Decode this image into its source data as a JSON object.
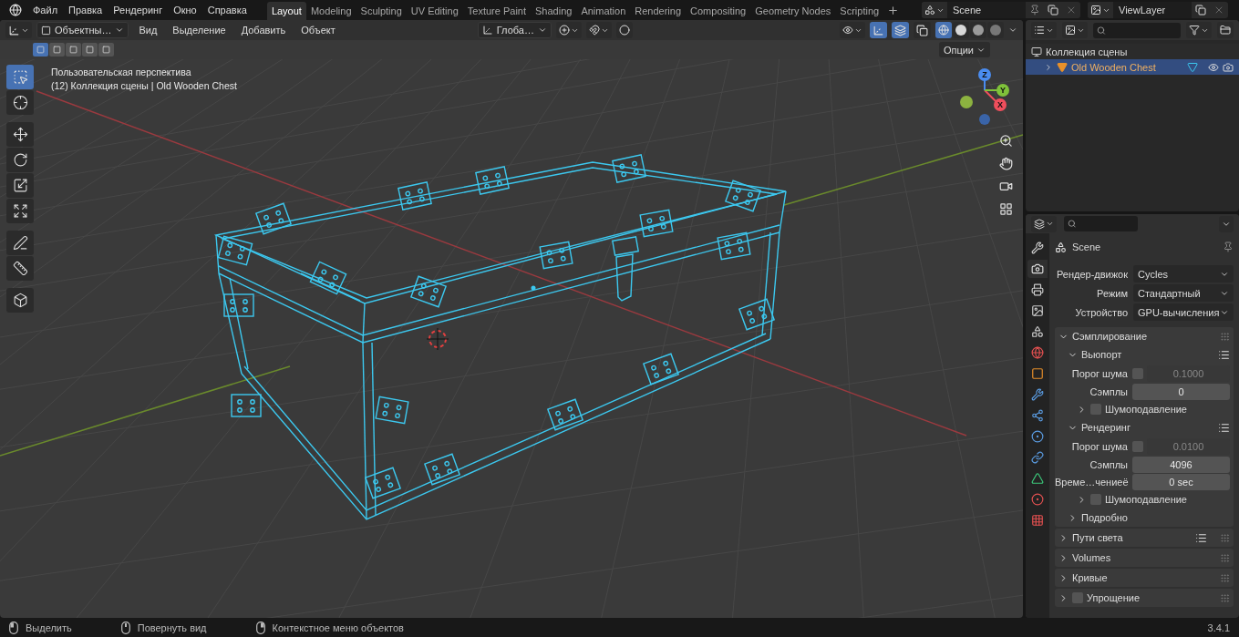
{
  "menu": [
    "Файл",
    "Правка",
    "Рендеринг",
    "Окно",
    "Справка"
  ],
  "workspaces": [
    {
      "label": "Layout",
      "selected": true
    },
    {
      "label": "Modeling",
      "selected": false
    },
    {
      "label": "Sculpting",
      "selected": false
    },
    {
      "label": "UV Editing",
      "selected": false
    },
    {
      "label": "Texture Paint",
      "selected": false
    },
    {
      "label": "Shading",
      "selected": false
    },
    {
      "label": "Animation",
      "selected": false
    },
    {
      "label": "Rendering",
      "selected": false
    },
    {
      "label": "Compositing",
      "selected": false
    },
    {
      "label": "Geometry Nodes",
      "selected": false
    },
    {
      "label": "Scripting",
      "selected": false
    }
  ],
  "scene": {
    "value": "Scene"
  },
  "view_layer": {
    "value": "ViewLayer"
  },
  "viewport": {
    "mode": "Объектны…",
    "menus": [
      "Вид",
      "Выделение",
      "Добавить",
      "Объект"
    ],
    "orientation": "Глоба…",
    "toggles": [
      {
        "kind": "gizmo",
        "on": true
      },
      {
        "kind": "overlays",
        "on": true
      },
      {
        "kind": "xray",
        "on": false
      }
    ],
    "shading": [
      {
        "kind": "wireframe",
        "selected": true
      },
      {
        "kind": "solid",
        "selected": false
      },
      {
        "kind": "material",
        "selected": false
      },
      {
        "kind": "rendered",
        "selected": false
      }
    ],
    "select_modes": [
      {
        "selected": true
      },
      {
        "selected": false
      },
      {
        "selected": false
      },
      {
        "selected": false
      },
      {
        "selected": false
      }
    ],
    "options": "Опции",
    "view_name": "Пользовательская перспектива",
    "context": "(12) Коллекция сцены | Old Wooden Chest",
    "tools": [
      {
        "kind": "select",
        "selected": true
      },
      {
        "kind": "cursor",
        "selected": false
      },
      {
        "kind": "move",
        "selected": false
      },
      {
        "kind": "rotate",
        "selected": false
      },
      {
        "kind": "scale",
        "selected": false
      },
      {
        "kind": "transform",
        "selected": false
      },
      {
        "kind": "annotate",
        "selected": false
      },
      {
        "kind": "measure",
        "selected": false
      },
      {
        "kind": "add-cube",
        "selected": false
      }
    ],
    "axes": [
      {
        "kind": "z",
        "label": "Z"
      },
      {
        "kind": "y",
        "label": "Y"
      },
      {
        "kind": "x",
        "label": "X"
      }
    ]
  },
  "outliner": {
    "collection": "Коллекция сцены",
    "objects": [
      {
        "name": "Old Wooden Chest",
        "selected": true
      }
    ]
  },
  "properties": {
    "tabs": [
      {
        "kind": "tool",
        "selected": false
      },
      {
        "kind": "render",
        "selected": true
      },
      {
        "kind": "output",
        "selected": false
      },
      {
        "kind": "view-layer",
        "selected": false
      },
      {
        "kind": "scene",
        "selected": false
      },
      {
        "kind": "world",
        "selected": false
      },
      {
        "kind": "object",
        "selected": false
      },
      {
        "kind": "modifiers",
        "selected": false
      },
      {
        "kind": "particles",
        "selected": false
      },
      {
        "kind": "physics",
        "selected": false
      },
      {
        "kind": "constraints",
        "selected": false
      },
      {
        "kind": "data",
        "selected": false
      },
      {
        "kind": "material",
        "selected": false
      },
      {
        "kind": "texture",
        "selected": false
      }
    ],
    "context": "Scene",
    "fields": [
      {
        "label": "Рендер-движок",
        "value": "Cycles"
      },
      {
        "label": "Режим",
        "value": "Стандартный"
      },
      {
        "label": "Устройство",
        "value": "GPU-вычисления"
      }
    ],
    "panels": [
      {
        "kind": "panel",
        "title": "Сэмплирование",
        "expanded": true,
        "children": [
          {
            "kind": "panel",
            "title": "Вьюпорт",
            "expanded": true,
            "presets": true,
            "children": [
              {
                "kind": "threshold",
                "label": "Порог шума",
                "checked": false,
                "value": "0.1000"
              },
              {
                "kind": "number",
                "label": "Сэмплы",
                "value": "0"
              },
              {
                "kind": "panel",
                "title": "Шумоподавление",
                "expanded": false,
                "checked": false
              }
            ]
          },
          {
            "kind": "panel",
            "title": "Рендеринг",
            "expanded": true,
            "presets": true,
            "children": [
              {
                "kind": "threshold",
                "label": "Порог шума",
                "checked": false,
                "value": "0.0100"
              },
              {
                "kind": "number",
                "label": "Сэмплы",
                "value": "4096"
              },
              {
                "kind": "number",
                "label": "Време…чениеё",
                "value": "0 sec"
              },
              {
                "kind": "panel",
                "title": "Шумоподавление",
                "expanded": false,
                "checked": false
              }
            ]
          },
          {
            "kind": "panel",
            "title": "Подробно",
            "expanded": false
          }
        ]
      },
      {
        "kind": "panel",
        "title": "Пути света",
        "expanded": false,
        "presets": true
      },
      {
        "kind": "panel",
        "title": "Volumes",
        "expanded": false
      },
      {
        "kind": "panel",
        "title": "Кривые",
        "expanded": false
      },
      {
        "kind": "panel",
        "title": "Упрощение",
        "expanded": false,
        "checked": false
      }
    ]
  },
  "status_bar": {
    "hints": [
      {
        "kind": "mouse-left",
        "label": "Выделить"
      },
      {
        "kind": "mouse-middle",
        "label": "Повернуть вид"
      },
      {
        "kind": "mouse-right",
        "label": "Контекстное меню объектов"
      }
    ],
    "version": "3.4.1"
  }
}
